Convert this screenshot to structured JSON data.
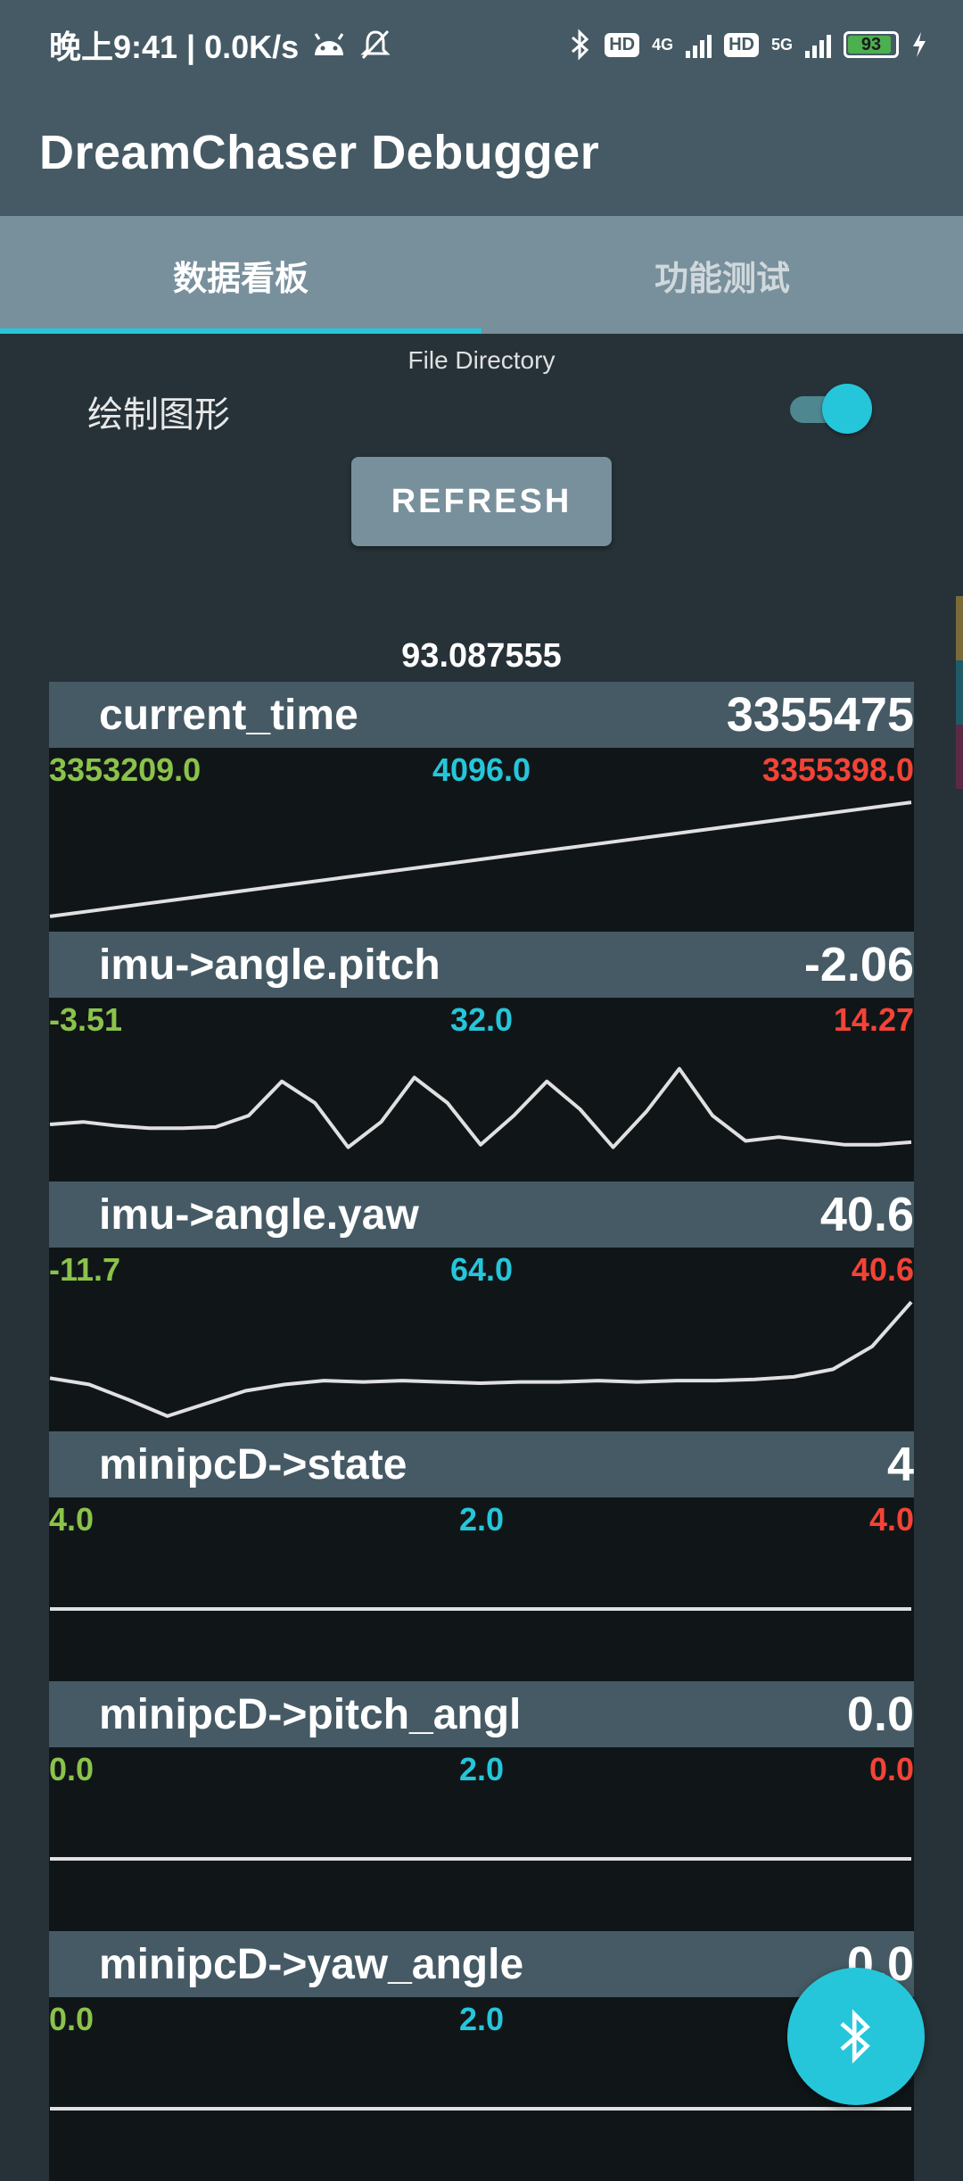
{
  "status_bar": {
    "time_speed": "晚上9:41 | 0.0K/s",
    "hd_label": "HD",
    "net_4g": "4G",
    "net_5g": "5G",
    "battery": "93",
    "icons": [
      "android-icon",
      "silent-bell-icon",
      "bluetooth-icon",
      "signal-icon",
      "charging-icon"
    ]
  },
  "app": {
    "title": "DreamChaser Debugger"
  },
  "tabs": [
    {
      "label": "数据看板",
      "active": true
    },
    {
      "label": "功能测试",
      "active": false
    }
  ],
  "controls": {
    "file_directory": "File Directory",
    "draw_label": "绘制图形",
    "draw_enabled": true,
    "refresh_label": "REFRESH"
  },
  "header_value": "93.087555",
  "panels": [
    {
      "name": "current_time",
      "value": "3355475",
      "min": "3353209.0",
      "count": "4096.0",
      "max": "3355398.0",
      "trace": [
        0.05,
        0.1,
        0.15,
        0.2,
        0.25,
        0.3,
        0.35,
        0.4,
        0.45,
        0.5,
        0.55,
        0.6,
        0.65,
        0.7,
        0.75,
        0.8,
        0.85,
        0.9,
        0.95
      ]
    },
    {
      "name": "imu->angle.pitch",
      "value": "-2.06",
      "min": "-3.51",
      "count": "32.0",
      "max": "14.27",
      "trace": [
        0.38,
        0.4,
        0.37,
        0.35,
        0.35,
        0.36,
        0.45,
        0.72,
        0.55,
        0.2,
        0.4,
        0.75,
        0.55,
        0.22,
        0.45,
        0.72,
        0.5,
        0.2,
        0.48,
        0.82,
        0.45,
        0.25,
        0.28,
        0.25,
        0.22,
        0.22,
        0.24
      ]
    },
    {
      "name": "imu->angle.yaw",
      "value": "40.6",
      "min": "-11.7",
      "count": "64.0",
      "max": "40.6",
      "trace": [
        0.35,
        0.3,
        0.18,
        0.05,
        0.15,
        0.25,
        0.3,
        0.33,
        0.32,
        0.33,
        0.32,
        0.31,
        0.32,
        0.32,
        0.33,
        0.32,
        0.33,
        0.33,
        0.34,
        0.36,
        0.42,
        0.6,
        0.95
      ]
    },
    {
      "name": "minipcD->state",
      "value": "4",
      "min": "4.0",
      "count": "2.0",
      "max": "4.0",
      "trace": [
        0.5,
        0.5,
        0.5,
        0.5
      ]
    },
    {
      "name": "minipcD->pitch_angl",
      "value": "0.0",
      "min": "0.0",
      "count": "2.0",
      "max": "0.0",
      "trace": [
        0.5,
        0.5,
        0.5,
        0.5
      ]
    },
    {
      "name": "minipcD->yaw_angle",
      "value": "0.0",
      "min": "0.0",
      "count": "2.0",
      "max": "",
      "trace": [
        0.5,
        0.5,
        0.5,
        0.5
      ]
    }
  ],
  "colors": {
    "min": "#8bc34a",
    "count": "#26c6da",
    "max": "#f44336",
    "trace": "#e0e0e0",
    "accent": "#26c6da"
  }
}
